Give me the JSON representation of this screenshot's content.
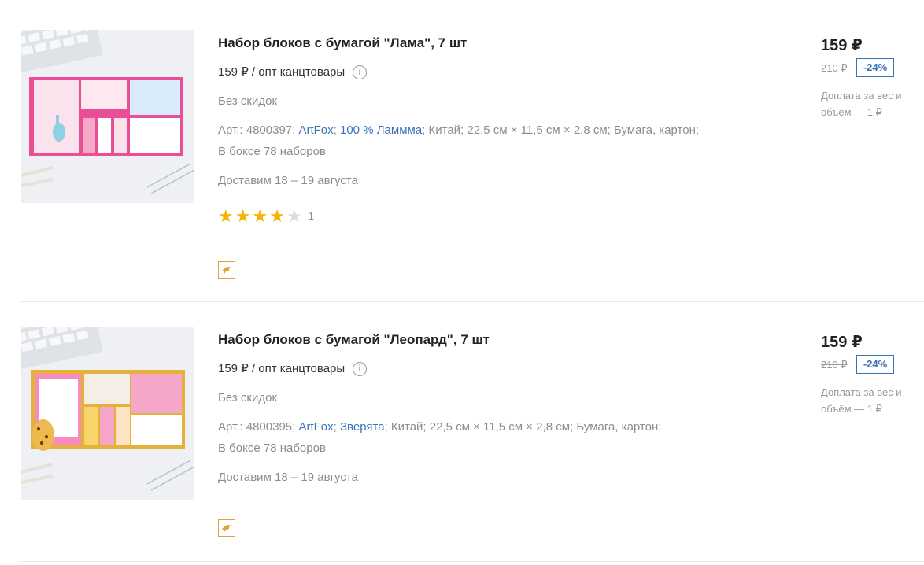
{
  "products": [
    {
      "title": "Набор блоков с бумагой \"Лама\", 7 шт",
      "wholesale_price": "159 ₽ / опт канцтовары",
      "info_icon": "info-icon",
      "no_discount": "Без скидок",
      "article_prefix": "Арт.: 4800397;",
      "brand": "ArtFox",
      "series": "100 % Ламмма",
      "meta_rest": "Китай;  22,5 см × 11,5 см × 2,8 см;  Бумага, картон;",
      "box": "В боксе 78 наборов",
      "delivery": "Доставим 18 – 19 августа",
      "rating": 4,
      "rating_count": "1",
      "badge_icon": "dolphin-icon",
      "price": "159 ₽",
      "old_price": "210 ₽",
      "discount": "-24%",
      "surcharge": "Доплата за вес и объём — 1 ₽"
    },
    {
      "title": "Набор блоков с бумагой \"Леопард\", 7 шт",
      "wholesale_price": "159 ₽ / опт канцтовары",
      "info_icon": "info-icon",
      "no_discount": "Без скидок",
      "article_prefix": "Арт.: 4800395;",
      "brand": "ArtFox",
      "series": "Зверята",
      "meta_rest": "Китай;  22,5 см × 11,5 см × 2,8 см;  Бумага, картон;",
      "box": "В боксе 78 наборов",
      "delivery": "Доставим 18 – 19 августа",
      "badge_icon": "dolphin-icon",
      "price": "159 ₽",
      "old_price": "210 ₽",
      "discount": "-24%",
      "surcharge": "Доплата за вес и объём — 1 ₽"
    }
  ],
  "colors": {
    "link": "#3a73b8",
    "star": "#f5b301",
    "badge_border": "#e0a23c"
  }
}
